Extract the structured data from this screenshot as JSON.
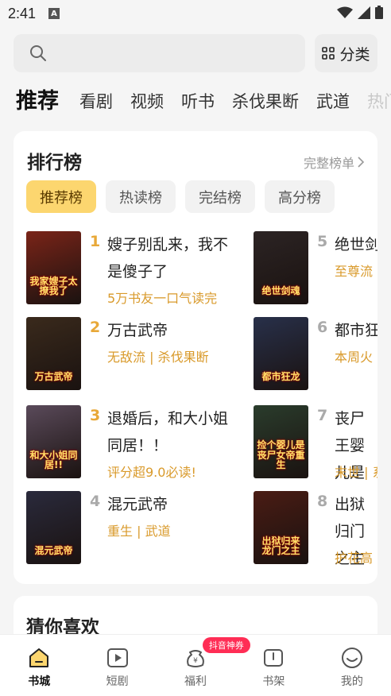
{
  "status": {
    "time": "2:41",
    "notif_letter": "A"
  },
  "search": {
    "placeholder": "",
    "category_label": "分类"
  },
  "tabs": [
    {
      "label": "推荐"
    },
    {
      "label": "看剧"
    },
    {
      "label": "视频"
    },
    {
      "label": "听书"
    },
    {
      "label": "杀伐果断"
    },
    {
      "label": "武道"
    },
    {
      "label": "热门"
    }
  ],
  "ranking": {
    "title": "排行榜",
    "more_label": "完整榜单",
    "tabs": [
      {
        "label": "推荐榜"
      },
      {
        "label": "热读榜"
      },
      {
        "label": "完结榜"
      },
      {
        "label": "高分榜"
      }
    ],
    "books": [
      {
        "rank": "1",
        "title": "嫂子别乱来，我不是傻子了",
        "tag": "5万书友一口气读完",
        "cover_text": "我家嫂子太撩我了",
        "cover_color": "#7a2418"
      },
      {
        "rank": "2",
        "title": "万古武帝",
        "tag": "无敌流 | 杀伐果断",
        "cover_text": "万古武帝",
        "cover_color": "#3a2a1c"
      },
      {
        "rank": "3",
        "title": "退婚后，和大小姐同居！！",
        "tag": "评分超9.0必读!",
        "cover_text": "和大小姐同居!!",
        "cover_color": "#5a4a5a"
      },
      {
        "rank": "4",
        "title": "混元武帝",
        "tag": "重生 | 武道",
        "cover_text": "混元武帝",
        "cover_color": "#2a2a3c"
      },
      {
        "rank": "5",
        "title": "绝世剑",
        "tag": "至尊流",
        "cover_text": "绝世剑魂",
        "cover_color": "#2c2424"
      },
      {
        "rank": "6",
        "title": "都市狂",
        "tag": "本周火",
        "cover_text": "都市狂龙",
        "cover_color": "#28304a"
      },
      {
        "rank": "7",
        "title": "丧尸王婴儿是",
        "tag": "末世 | 系",
        "cover_text": "捡个婴儿是丧尸女帝重生",
        "cover_color": "#2a3c2c"
      },
      {
        "rank": "8",
        "title": "出狱归门之主",
        "tag": "护花高",
        "cover_text": "出狱归来 龙门之主",
        "cover_color": "#4a1c14"
      }
    ]
  },
  "guess": {
    "title": "猜你喜欢"
  },
  "nav": [
    {
      "label": "书城",
      "icon": "home-icon"
    },
    {
      "label": "短剧",
      "icon": "play-icon"
    },
    {
      "label": "福利",
      "icon": "coin-bag-icon",
      "badge": "抖音神券"
    },
    {
      "label": "书架",
      "icon": "bookshelf-icon"
    },
    {
      "label": "我的",
      "icon": "smile-icon"
    }
  ]
}
